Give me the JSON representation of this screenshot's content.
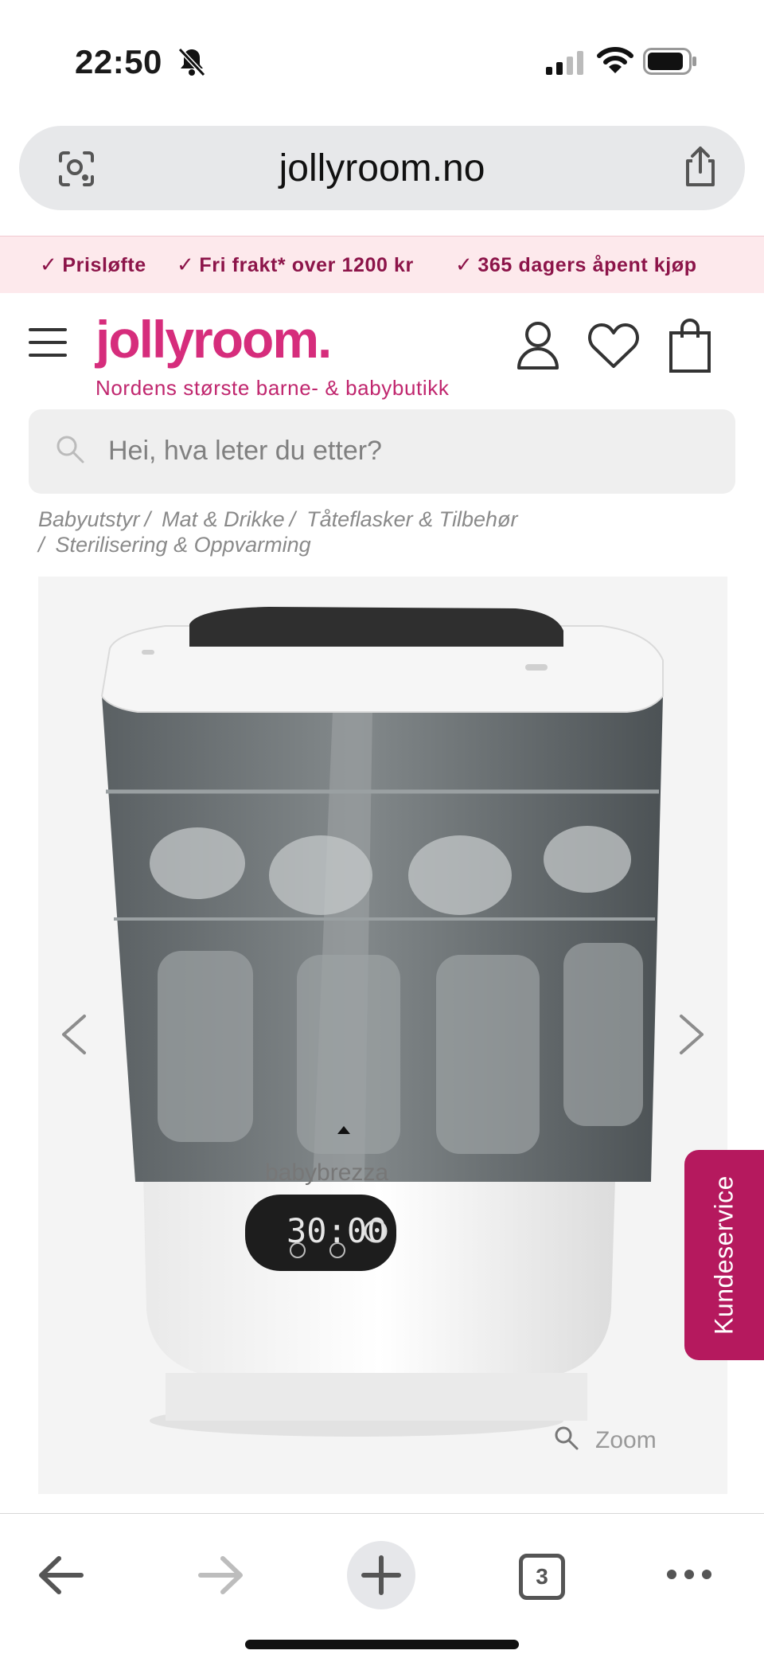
{
  "status_bar": {
    "time": "22:50"
  },
  "browser": {
    "url": "jollyroom.no"
  },
  "promo": {
    "items": [
      "Prisløfte",
      "Fri frakt* over 1200 kr",
      "365 dagers åpent kjøp"
    ],
    "check": "✓"
  },
  "header": {
    "logo": "jollyroom.",
    "tagline": "Nordens største barne- & babybutikk"
  },
  "search": {
    "placeholder": "Hei, hva leter du etter?"
  },
  "breadcrumb": {
    "items": [
      "Babyutstyr",
      "Mat & Drikke",
      "Tåteflasker & Tilbehør",
      "Sterilisering & Oppvarming"
    ],
    "separator": "/"
  },
  "product": {
    "brand_on_device": "babybrezza",
    "display_reading": "30:00",
    "zoom_label": "Zoom"
  },
  "side_tab": {
    "label": "Kundeservice"
  },
  "toolbar": {
    "tab_count": "3"
  },
  "colors": {
    "brand": "#d62d7c",
    "promo_bg": "#fde9ec",
    "promo_text": "#8c1449",
    "side_tab": "#b5195e"
  }
}
